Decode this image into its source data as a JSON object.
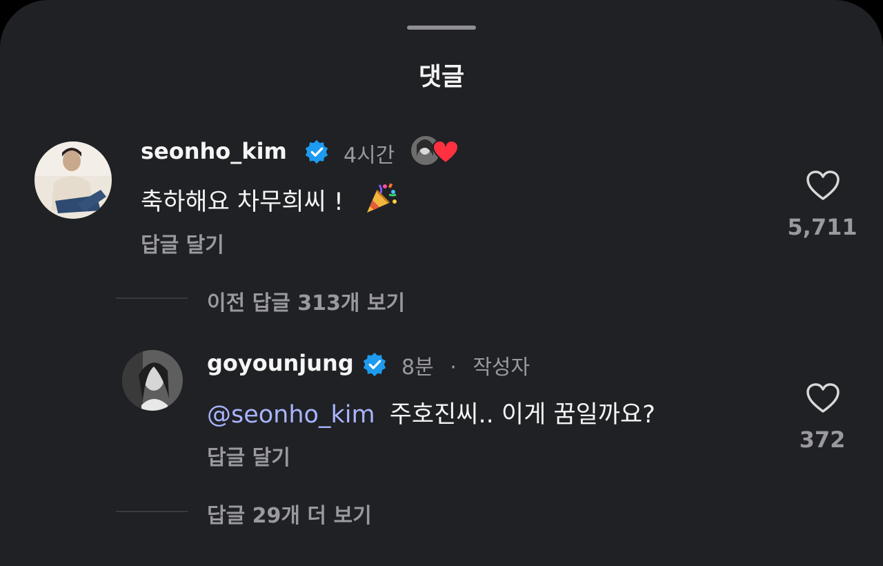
{
  "sheet": {
    "title": "댓글"
  },
  "comments": [
    {
      "username": "seonho_kim",
      "time": "4시간",
      "text": "축하해요 차무희씨 !",
      "reply_label": "답글 달기",
      "likes": "5,711"
    },
    {
      "username": "goyounjung",
      "time": "8분",
      "separator": "·",
      "author_tag": "작성자",
      "mention": "@seonho_kim",
      "text": "주호진씨.. 이게 꿈일까요?",
      "reply_label": "답글 달기",
      "likes": "372"
    }
  ],
  "view_previous_replies": "이전 답글 313개 보기",
  "view_more_replies": "답글 29개 더 보기",
  "colors": {
    "background": "#202124",
    "verified_badge": "#1d9bf0",
    "mention": "#a8b4ff",
    "heart": "#ff3040"
  },
  "icons": [
    "verified-badge-icon",
    "heart-outline-icon",
    "liked-heart-icon",
    "party-popper-icon",
    "threads-at-icon"
  ]
}
